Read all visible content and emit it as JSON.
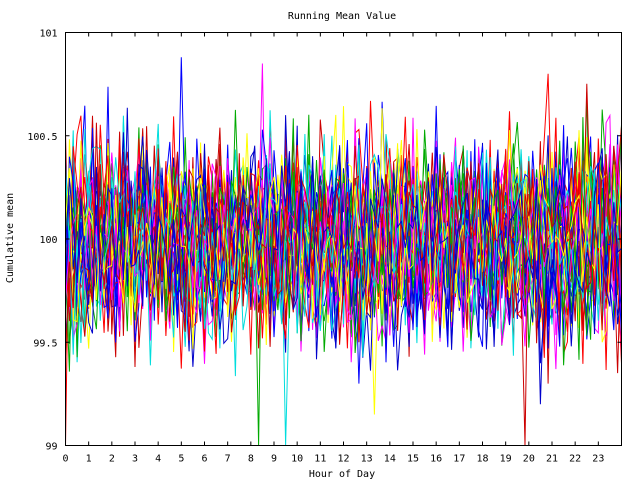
{
  "chart_data": {
    "type": "line",
    "title": "Running Mean Value",
    "xlabel": "Hour of Day",
    "ylabel": "Cumulative mean",
    "xlim": [
      0,
      24
    ],
    "ylim": [
      99,
      101
    ],
    "x_ticks": [
      0,
      1,
      2,
      3,
      4,
      5,
      6,
      7,
      8,
      9,
      10,
      11,
      12,
      13,
      14,
      15,
      16,
      17,
      18,
      19,
      20,
      21,
      22,
      23
    ],
    "y_ticks": [
      {
        "value": 99,
        "label": "99"
      },
      {
        "value": 99.5,
        "label": "99.5"
      },
      {
        "value": 100,
        "label": "100"
      },
      {
        "value": 100.5,
        "label": "100.5"
      },
      {
        "value": 101,
        "label": "101"
      }
    ],
    "grid": false,
    "legend": "none",
    "series_count": 40,
    "points_per_hour": 6,
    "series_colors": [
      "#ff0000",
      "#0000ff",
      "#00aa00",
      "#ff00ff",
      "#00dddd",
      "#ffff00",
      "#cc0000",
      "#0000cc"
    ],
    "center_value": 100.0,
    "typical_band": [
      99.6,
      100.45
    ],
    "notable_excursions": [
      {
        "hour": 0.0,
        "value": 99.0
      },
      {
        "hour": 5.0,
        "value": 100.88
      },
      {
        "hour": 8.3,
        "value": 99.0
      },
      {
        "hour": 8.5,
        "value": 100.85
      },
      {
        "hour": 9.5,
        "value": 99.0
      },
      {
        "hour": 13.4,
        "value": 99.15
      },
      {
        "hour": 19.8,
        "value": 99.0
      },
      {
        "hour": 20.5,
        "value": 99.2
      },
      {
        "hour": 20.8,
        "value": 100.8
      }
    ]
  }
}
